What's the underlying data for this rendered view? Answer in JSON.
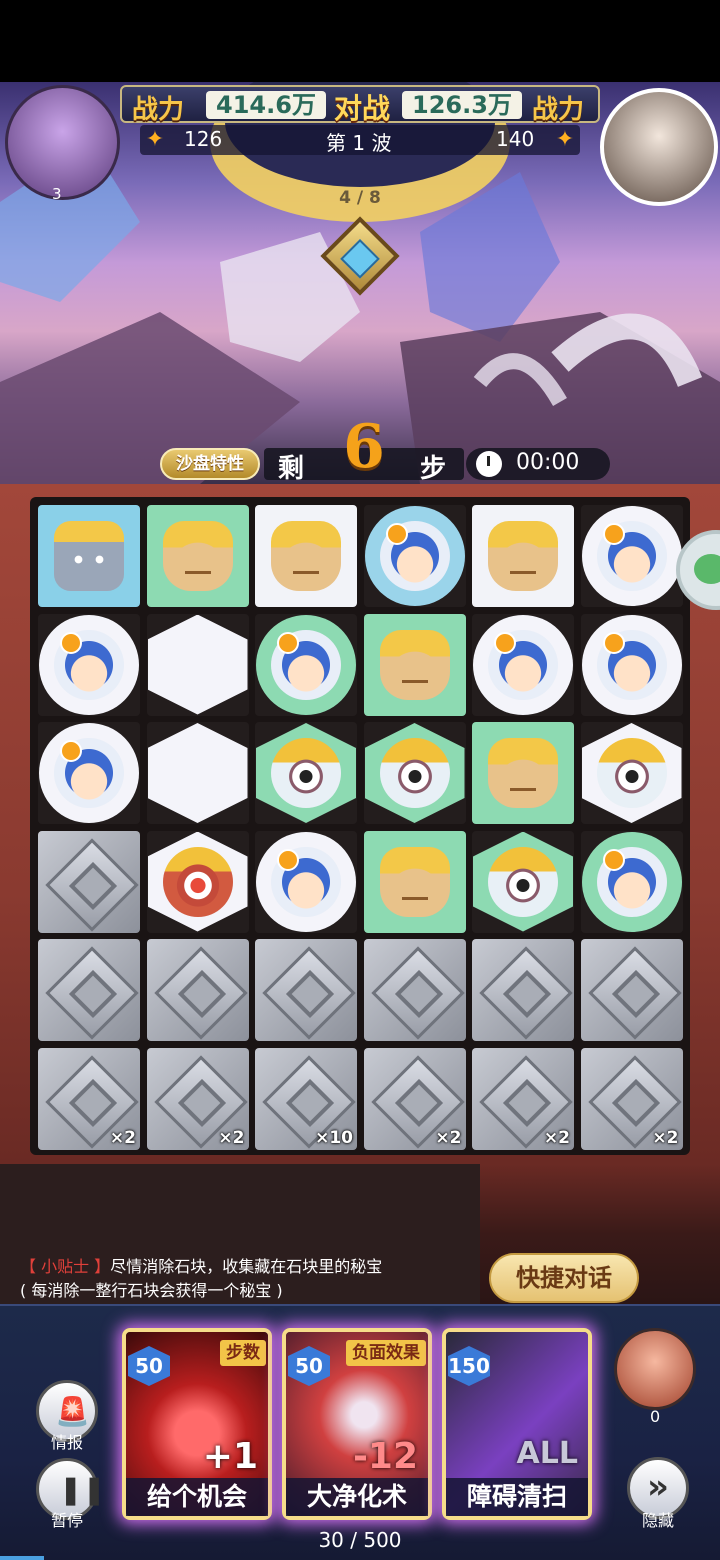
{
  "header": {
    "power_label_left": "战力",
    "power_left": "414.6万",
    "vs_label": "对战",
    "power_right": "126.3万",
    "power_label_right": "战力",
    "stars_left": "126",
    "wave_label": "第 1 波",
    "stars_right": "140",
    "wave_progress": "4 / 8",
    "left_avatar_badge": "3"
  },
  "status": {
    "feature_button": "沙盘特性",
    "remaining_prefix": "剩",
    "remaining_steps": "6",
    "remaining_suffix": "步",
    "timer": "00:00"
  },
  "board": {
    "rows": [
      [
        "robot",
        "cake",
        "cake",
        "girl",
        "cake",
        "girl"
      ],
      [
        "girl",
        "empty",
        "girl",
        "cake",
        "girl",
        "girl"
      ],
      [
        "girl",
        "empty",
        "eye",
        "eye",
        "cake",
        "eye"
      ],
      [
        "stone",
        "heart",
        "girl",
        "cake",
        "eye",
        "girl"
      ],
      [
        "stone",
        "stone",
        "stone",
        "stone",
        "stone",
        "stone"
      ],
      [
        "stone",
        "stone",
        "stone",
        "stone",
        "stone",
        "stone"
      ]
    ],
    "bottom_multipliers": [
      "×2",
      "×2",
      "×10",
      "×2",
      "×2",
      "×2"
    ]
  },
  "tips": {
    "tag": "【 小贴士 】",
    "line1": "尽情消除石块，收集藏在石块里的秘宝",
    "line2": "( 每消除一整行石块会获得一个秘宝 )",
    "quick_chat_button": "快捷对话"
  },
  "skills": {
    "intel_label": "情报",
    "pause_label": "暂停",
    "cards": [
      {
        "cost": "50",
        "tag": "步数",
        "value": "+1",
        "name": "给个机会"
      },
      {
        "cost": "50",
        "tag": "负面效果",
        "value": "-12",
        "name": "大净化术"
      },
      {
        "cost": "150",
        "tag": "",
        "value": "ALL",
        "name": "障碍清扫"
      }
    ],
    "helper_count": "0",
    "hide_label": "隐藏",
    "energy": "30 / 500"
  },
  "colors": {
    "accent_gold": "#f6c64a",
    "steps_orange": "#f5a21a",
    "tip_red": "#e0403a",
    "cell_green": "#8ddab2",
    "cell_white": "#f2f3f8"
  }
}
